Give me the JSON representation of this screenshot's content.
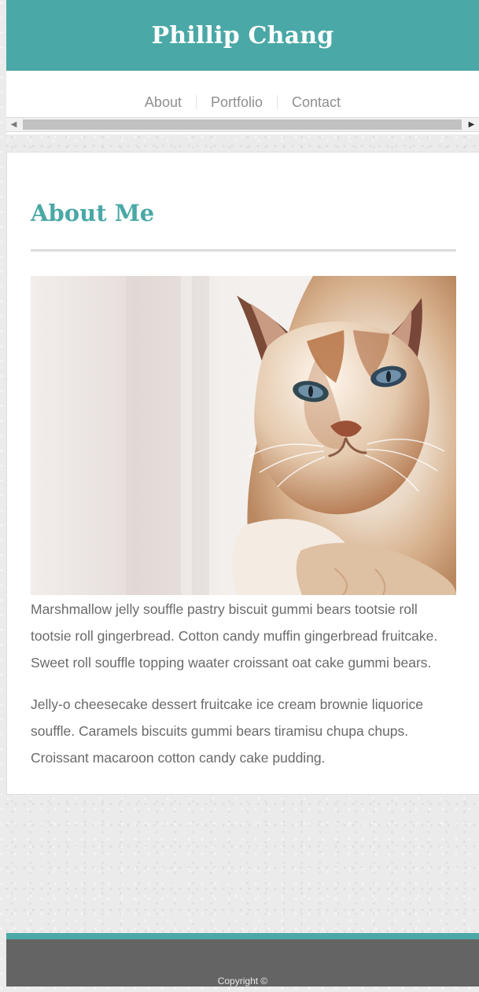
{
  "header": {
    "title": "Phillip Chang"
  },
  "nav": {
    "items": [
      {
        "label": "About"
      },
      {
        "label": "Portfolio"
      },
      {
        "label": "Contact"
      }
    ]
  },
  "main": {
    "heading": "About Me",
    "image_alt_icon": "cat-photo",
    "paragraphs": [
      "Marshmallow jelly souffle pastry biscuit gummi bears tootsie roll tootsie roll gingerbread. Cotton candy muffin gingerbread fruitcake. Sweet roll souffle topping waater croissant oat cake gummi bears.",
      "Jelly-o cheesecake dessert fruitcake ice cream brownie liquorice souffle. Caramels biscuits gummi bears tiramisu chupa chups. Croissant macaroon cotton candy cake pudding."
    ]
  },
  "footer": {
    "copyright": "Copyright ©"
  },
  "colors": {
    "accent": "#4aa8a6",
    "footer": "#646464",
    "text": "#6a6a6a",
    "nav_text": "#8f8f8f",
    "page_background": "#ebebeb"
  }
}
